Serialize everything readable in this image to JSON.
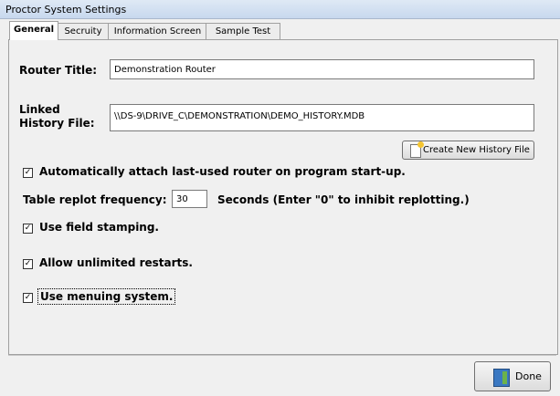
{
  "window": {
    "title": "Proctor System Settings"
  },
  "tabs": [
    {
      "label": "General",
      "active": true
    },
    {
      "label": "Secruity",
      "active": false
    },
    {
      "label": "Information Screen",
      "active": false
    },
    {
      "label": "Sample Test",
      "active": false
    }
  ],
  "router": {
    "label": "Router Title:",
    "value": "Demonstration Router"
  },
  "history": {
    "label": "Linked History File:",
    "value": "\\\\DS-9\\DRIVE_C\\DEMONSTRATION\\DEMO_HISTORY.MDB",
    "create_button": "Create New History File",
    "create_icon": "new-file-icon"
  },
  "options": {
    "auto_attach": {
      "label": "Automatically attach last-used router on program start-up.",
      "checked": true
    },
    "replot": {
      "label": "Table replot frequency:",
      "value": "30",
      "suffix": "Seconds (Enter \"0\" to inhibit replotting.)"
    },
    "field_stamping": {
      "label": "Use field stamping.",
      "checked": true
    },
    "unlimited_restarts": {
      "label": "Allow unlimited restarts.",
      "checked": true
    },
    "menuing": {
      "label": "Use menuing system.",
      "checked": true
    }
  },
  "footer": {
    "done_label": "Done",
    "done_icon": "exit-door-icon"
  },
  "check_glyph": "✓"
}
